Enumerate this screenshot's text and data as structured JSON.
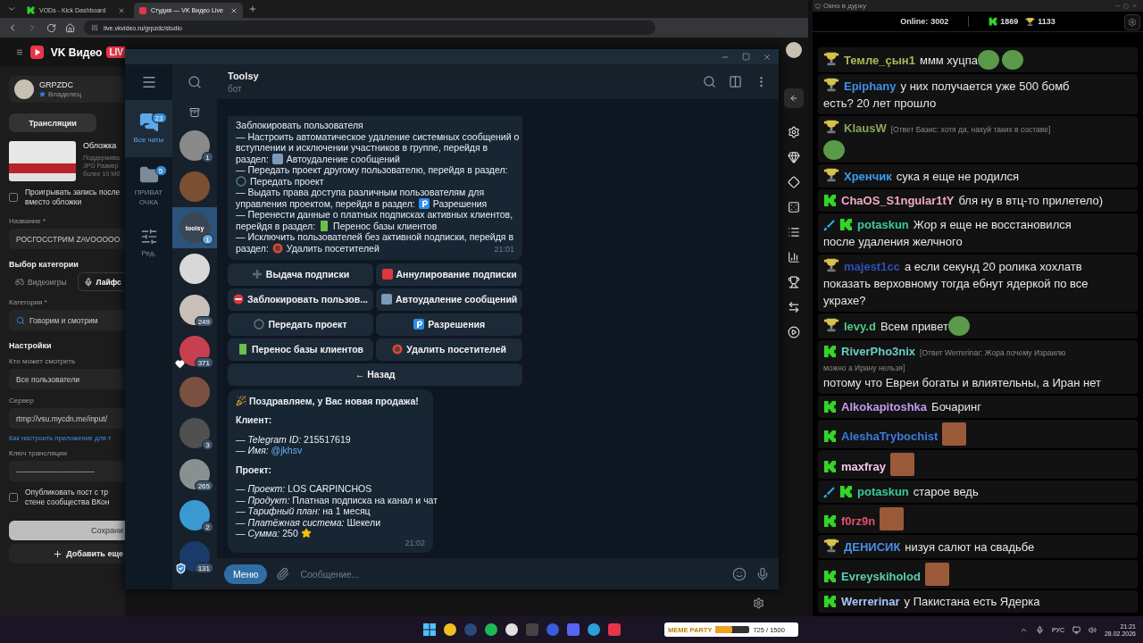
{
  "browser": {
    "tabs": [
      {
        "title": "VODs - Kick Dashboard",
        "kind": "kick",
        "selected": false
      },
      {
        "title": "Студия — VK Видео Live",
        "kind": "vk",
        "selected": true
      }
    ],
    "address": "live.vkvideo.ru/grpzdc/studio"
  },
  "studio": {
    "logo": "VK Видео",
    "live_badge": "LIV",
    "profile": {
      "name": "GRPZDC",
      "role": "Владелец"
    },
    "tab": "Трансляции",
    "cover": {
      "title": "Обложка",
      "hint_lines": [
        "Поддержива",
        "JPG Размер",
        "более 10 Мб"
      ]
    },
    "autoplay": {
      "checked": false,
      "lines": [
        "Проигрывать запись после",
        "вместо обложки"
      ]
    },
    "title_label": "Название *",
    "title_value": "РОСГОССТРИМ ZAVOOOOO",
    "category_heading": "Выбор категории",
    "category_tabs": [
      {
        "label": "Видеоигры",
        "kind": "games",
        "selected": false
      },
      {
        "label": "Лайфс",
        "kind": "life",
        "selected": true
      }
    ],
    "category_label": "Категория *",
    "category_value": "Говорим и смотрим",
    "settings_heading": "Настройки",
    "viewers_label": "Кто может смотреть",
    "viewers_value": "Все пользователи",
    "server_label": "Сервер",
    "server_value": "rtmp://vsu.mycdn.me/input/",
    "help_link": "Как настроить приложение для т",
    "key_label": "Ключ трансляции",
    "key_value": "-------------------------------",
    "publish": {
      "checked": false,
      "lines": [
        "Опубликовать пост с тр",
        "стене сообщества ВКон"
      ]
    },
    "save_button": "Сохрани",
    "add_button": "Добавить еще"
  },
  "telegram": {
    "folders": [
      {
        "label": "Все чаты",
        "badge": "23",
        "kind": "all",
        "selected": true
      },
      {
        "label": "ПРИВАТ ОЧКА",
        "badge": "5",
        "kind": "folder",
        "selected": false
      },
      {
        "label": "Ред.",
        "kind": "edit",
        "selected": false
      }
    ],
    "chats": [
      {
        "kind": "photo",
        "badge": "1",
        "liked": false,
        "verified": false,
        "selected": false
      },
      {
        "kind": "photo",
        "liked": false,
        "verified": false,
        "selected": false
      },
      {
        "kind": "logo",
        "label": "toolsy",
        "badge": "1",
        "liked": false,
        "verified": false,
        "selected": true
      },
      {
        "kind": "photo",
        "liked": false,
        "verified": false,
        "selected": false
      },
      {
        "kind": "photo",
        "badge": "249",
        "liked": false,
        "verified": false,
        "selected": false
      },
      {
        "kind": "photo",
        "badge": "371",
        "liked": true,
        "verified": false,
        "selected": false
      },
      {
        "kind": "photo",
        "liked": false,
        "verified": false,
        "selected": false
      },
      {
        "kind": "photo",
        "badge": "3",
        "liked": false,
        "verified": false,
        "selected": false
      },
      {
        "kind": "photo",
        "badge": "265",
        "liked": false,
        "verified": false,
        "selected": false
      },
      {
        "kind": "photo",
        "badge": "2",
        "liked": false,
        "verified": false,
        "selected": false
      },
      {
        "kind": "photo",
        "badge": "131",
        "liked": false,
        "verified": true,
        "selected": false
      }
    ],
    "chat_title": "Toolsy",
    "chat_status": "бот",
    "menu_message": {
      "items": [
        {
          "lines": [
            "Заблокировать пользователя"
          ]
        },
        {
          "kind": "autodelete",
          "lines": [
            "— Настроить автоматическое удаление системных сообщений о",
            "вступлении и исключении участников в группе, перейдя в"
          ],
          "tail": "раздел:",
          "target": "Автоудаление сообщений"
        },
        {
          "kind": "transfer",
          "lines": [
            "— Передать проект другому пользователю, перейдя в раздел:"
          ],
          "target": "Передать проект"
        },
        {
          "kind": "permissions",
          "lines": [
            "— Выдать права доступа различным пользователям для"
          ],
          "tail": "управления проектом, перейдя в раздел:",
          "target": "Разрешения"
        },
        {
          "kind": "book",
          "lines": [
            "— Перенести данные о платных подписках активных клиентов,"
          ],
          "tail": "перейдя в раздел:",
          "target": "Перенос базы клиентов"
        },
        {
          "kind": "remove",
          "lines": [
            "— Исключить пользователей без активной подписки, перейдя в"
          ],
          "tail": "раздел:",
          "target": "Удалить посетителей"
        }
      ],
      "time": "21:01"
    },
    "keyboard": [
      {
        "label": "Выдача подписки",
        "kind": "plus"
      },
      {
        "label": "Аннулирование подписки",
        "kind": "cancel"
      },
      {
        "label": "Заблокировать пользов...",
        "kind": "block"
      },
      {
        "label": "Автоудаление сообщений",
        "kind": "autodelete"
      },
      {
        "label": "Передать проект",
        "kind": "transfer"
      },
      {
        "label": "Разрешения",
        "kind": "permissions"
      },
      {
        "label": "Перенос базы клиентов",
        "kind": "book"
      },
      {
        "label": "Удалить посетителей",
        "kind": "remove"
      },
      {
        "label": "← Назад",
        "kind": "plain"
      }
    ],
    "sale_message": {
      "title": "Поздравляем, у Вас новая продажа!",
      "sections": [
        {
          "heading": "Клиент:",
          "fields": [
            {
              "label": "— Telegram ID:",
              "value": "215517619",
              "kind": "text"
            },
            {
              "label": "— Имя:",
              "value": "@jkhsv",
              "kind": "link"
            }
          ]
        },
        {
          "heading": "Проект:",
          "fields": [
            {
              "label": "— Проект:",
              "value": "LOS CARPINCHOS",
              "kind": "text"
            },
            {
              "label": "— Продукт:",
              "value": "Платная подписка на канал и чат",
              "kind": "text"
            },
            {
              "label": "— Тарифный план:",
              "value": "на 1 месяц",
              "kind": "text"
            },
            {
              "label": "— Платёжная система:",
              "value": "Шекели",
              "kind": "text"
            },
            {
              "label": "— Сумма:",
              "value": "250",
              "kind": "star"
            }
          ]
        }
      ],
      "time": "21:02"
    },
    "menu_button": "Меню",
    "input_placeholder": "Сообщение..."
  },
  "stream_chat": {
    "window_title": "Окно в дурку",
    "online_label": "Online:",
    "online": "3002",
    "kick_count": "1869",
    "trophy_count": "1133",
    "messages": [
      {
        "badges": [
          {
            "kind": "trophy"
          }
        ],
        "name": "Темле_çын1",
        "color": "#a9b85a",
        "lines": [
          "ммм хуцпа"
        ],
        "emotes": [
          {
            "kind": "sticker"
          },
          {
            "kind": "sticker"
          }
        ]
      },
      {
        "badges": [
          {
            "kind": "trophy"
          }
        ],
        "name": "Epiphany",
        "color": "#3d8fe8",
        "lines": [
          "у них получается уже 500 бомб",
          "есть? 20 лет прошло"
        ]
      },
      {
        "badges": [
          {
            "kind": "trophy"
          }
        ],
        "name": "KlausW",
        "color": "#8aa65a",
        "reply_lines": [
          "[Ответ Базис: хотя да, нахуй таких  в составе]"
        ],
        "emotes": [
          {
            "kind": "sticker"
          }
        ]
      },
      {
        "badges": [
          {
            "kind": "trophy"
          }
        ],
        "name": "Хренчик",
        "color": "#3a9ef0",
        "lines": [
          "сука я еще не родился"
        ]
      },
      {
        "badges": [
          {
            "kind": "kick"
          }
        ],
        "name": "ChaOS_S1ngular1tY",
        "color": "#f0a8c4",
        "lines": [
          "бля ну в втц-то прилетело)"
        ]
      },
      {
        "badges": [
          {
            "kind": "sword"
          },
          {
            "kind": "kick"
          }
        ],
        "name": "potaskun",
        "color": "#3cc8a0",
        "lines": [
          "Жор я еще не восстановился",
          "после удаления желчного"
        ]
      },
      {
        "badges": [
          {
            "kind": "trophy"
          }
        ],
        "name": "majest1cc",
        "color": "#2f4fb8",
        "lines": [
          "а если секунд 20 ролика хохлатв",
          "показать верховному тогда ебнут ядеркой по все",
          "украхе?"
        ]
      },
      {
        "badges": [
          {
            "kind": "trophy"
          }
        ],
        "name": "levy.d",
        "color": "#4fc98a",
        "lines": [
          "Всем привет"
        ],
        "emotes": [
          {
            "kind": "sticker"
          }
        ]
      },
      {
        "badges": [
          {
            "kind": "kick"
          }
        ],
        "name": "RiverPho3nix",
        "color": "#6ccdc0",
        "reply_lines": [
          "[Ответ Werrerinar: Жора почему Израилю",
          "можно а Ирану нельзя]"
        ],
        "lines": [
          "потому что Евреи богаты и влиятельны, а Иран нет"
        ]
      },
      {
        "badges": [
          {
            "kind": "kick"
          }
        ],
        "name": "Alkokapitoshka",
        "color": "#c29af0",
        "lines": [
          "Бочаринг"
        ]
      },
      {
        "badges": [
          {
            "kind": "kick"
          }
        ],
        "name": "AleshaTrybochist",
        "color": "#3f78e0",
        "emotes": [
          {
            "kind": "photo"
          }
        ]
      },
      {
        "badges": [
          {
            "kind": "kick"
          }
        ],
        "name": "maxfray",
        "color": "#f2c8e2",
        "emotes": [
          {
            "kind": "photo"
          }
        ]
      },
      {
        "badges": [
          {
            "kind": "sword"
          },
          {
            "kind": "kick"
          }
        ],
        "name": "potaskun",
        "color": "#3cc8a0",
        "lines": [
          "старое ведь"
        ]
      },
      {
        "badges": [
          {
            "kind": "kick"
          }
        ],
        "name": "f0rz9n",
        "color": "#e0506e",
        "emotes": [
          {
            "kind": "photo"
          }
        ]
      },
      {
        "badges": [
          {
            "kind": "trophy"
          }
        ],
        "name": "ДЕНИСИК",
        "color": "#4a8ee6",
        "lines": [
          "низуя салют на свадьбе"
        ]
      },
      {
        "badges": [
          {
            "kind": "kick"
          }
        ],
        "name": "Evreyskiholod",
        "color": "#5cd0b0",
        "emotes": [
          {
            "kind": "photo"
          }
        ]
      },
      {
        "badges": [
          {
            "kind": "kick"
          }
        ],
        "name": "Werrerinar",
        "color": "#a6c8ff",
        "lines": [
          "у Пакистана есть Ядерка"
        ]
      }
    ]
  },
  "taskbar": {
    "widget": {
      "title": "MEME PARTY",
      "reading": "725 / 1500",
      "level": 0.48
    },
    "language": "РУС",
    "time": "21:21",
    "date": "28.02.2026"
  }
}
